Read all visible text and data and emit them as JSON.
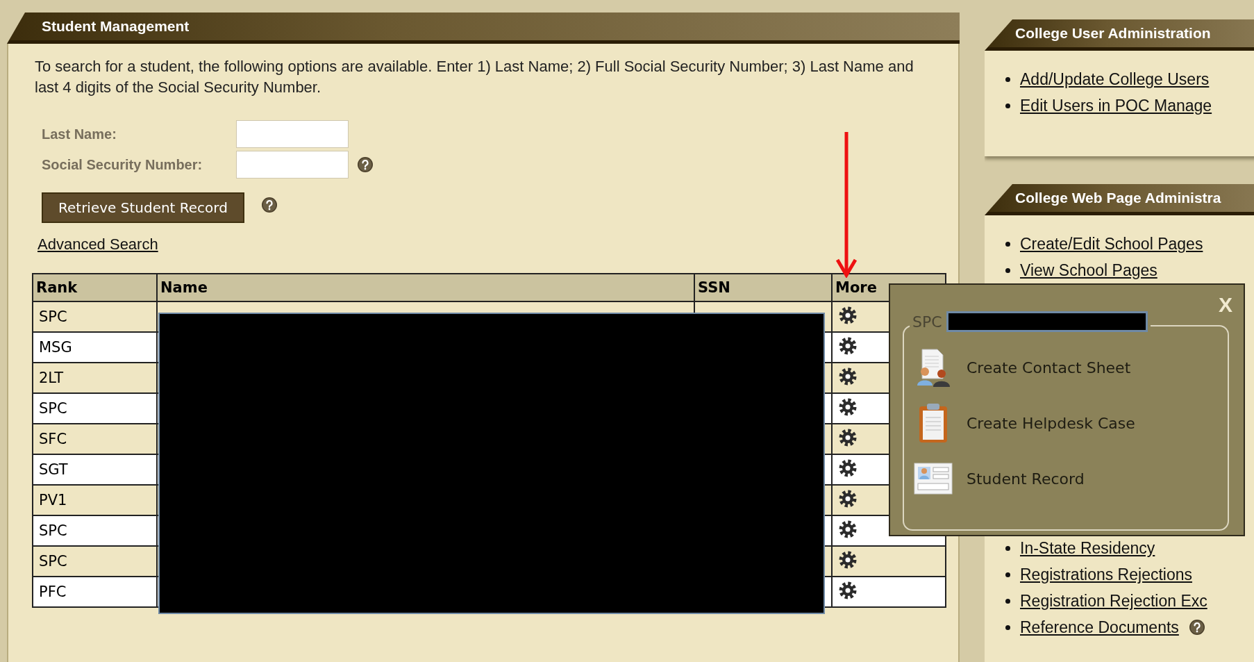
{
  "student_management": {
    "title": "Student Management",
    "instructions": "To search for a student, the following options are available. Enter 1) Last Name; 2) Full Social Security Number; 3) Last Name and last 4 digits of the Social Security Number.",
    "fields": [
      {
        "label": "Last Name:",
        "help": false
      },
      {
        "label": "Social Security Number:",
        "help": true
      }
    ],
    "retrieve_button": {
      "label": "Retrieve Student Record",
      "help": true
    },
    "advanced_search": "Advanced Search",
    "table": {
      "columns": [
        "Rank",
        "Name",
        "SSN",
        "More"
      ],
      "rows": [
        {
          "rank": "SPC"
        },
        {
          "rank": "MSG"
        },
        {
          "rank": "2LT"
        },
        {
          "rank": "SPC"
        },
        {
          "rank": "SFC"
        },
        {
          "rank": "SGT"
        },
        {
          "rank": "PV1"
        },
        {
          "rank": "SPC"
        },
        {
          "rank": "SPC"
        },
        {
          "rank": "PFC"
        }
      ]
    }
  },
  "sidebar": [
    {
      "title": "College User Administration",
      "links": [
        {
          "label": "Add/Update College Users",
          "help": false
        },
        {
          "label": "Edit Users in POC Manage",
          "help": false
        }
      ]
    },
    {
      "title": "College Web Page Administra",
      "links": [
        {
          "label": "Create/Edit School Pages",
          "help": false
        },
        {
          "label": "View School Pages",
          "help": false
        },
        {
          "label": "In-State Residency",
          "help": false
        },
        {
          "label": "Registrations Rejections",
          "help": false
        },
        {
          "label": "Registration Rejection Exc",
          "help": false
        },
        {
          "label": "Reference Documents",
          "help": true
        }
      ]
    }
  ],
  "popup": {
    "title": "SPC",
    "close": "X",
    "items": [
      {
        "label": "Create Contact Sheet",
        "kind": "contacts"
      },
      {
        "label": "Create Helpdesk Case",
        "kind": "clipboard"
      },
      {
        "label": "Student Record",
        "kind": "record"
      }
    ]
  }
}
